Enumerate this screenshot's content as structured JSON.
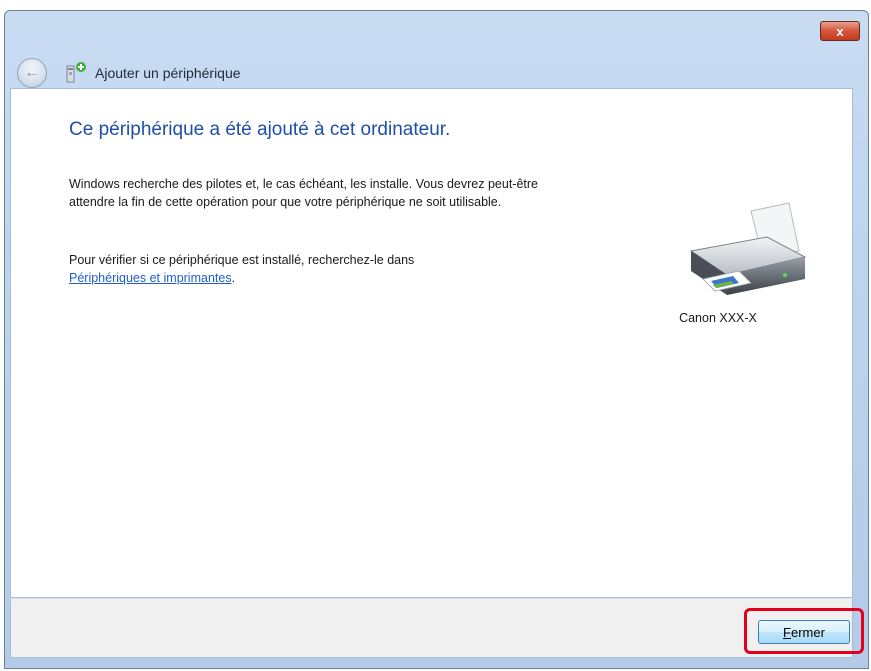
{
  "window": {
    "close_label": "x"
  },
  "header": {
    "title": "Ajouter un périphérique",
    "back_icon": "back-arrow-icon",
    "device_icon": "device-add-icon"
  },
  "content": {
    "headline": "Ce périphérique a été ajouté à cet ordinateur.",
    "paragraph1": "Windows recherche des pilotes et, le cas échéant, les installe. Vous devrez peut-être attendre la fin de cette opération pour que votre périphérique ne soit utilisable.",
    "paragraph2_text": "Pour vérifier si ce périphérique est installé, recherchez-le dans",
    "paragraph2_link": "Périphériques et imprimantes",
    "paragraph2_end": ".",
    "device_name": "Canon XXX-X",
    "device_icon": "printer-icon"
  },
  "footer": {
    "close_button_first": "F",
    "close_button_rest": "ermer"
  },
  "colors": {
    "headline": "#1f4fa8",
    "link": "#1f5fcf",
    "highlight": "#e2001a"
  }
}
